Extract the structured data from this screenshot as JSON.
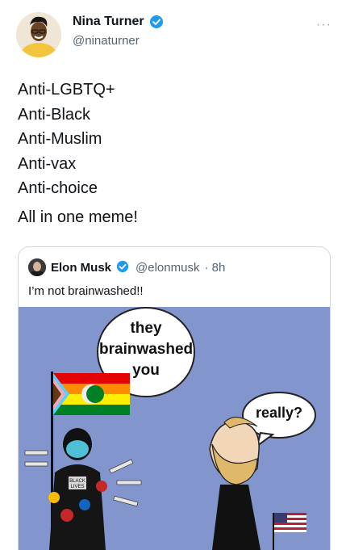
{
  "author": {
    "name": "Nina Turner",
    "handle": "@ninaturner"
  },
  "tweet": {
    "lines": [
      "Anti-LGBTQ+",
      "Anti-Black",
      "Anti-Muslim",
      "Anti-vax",
      "Anti-choice"
    ],
    "tail": "All in one meme!"
  },
  "quoted": {
    "name": "Elon Musk",
    "handle": "@elonmusk",
    "time": "· 8h",
    "text": "I’m not brainwashed!!",
    "meme": {
      "left_bubble": [
        "they",
        "brainwashed",
        "you"
      ],
      "right_bubble": "really?",
      "patch_text": [
        "BLACK",
        "LIVES"
      ]
    }
  },
  "colors": {
    "verified_blue": "#1d9bf0",
    "meme_background": "#8395cd",
    "muted_text": "#536471"
  }
}
